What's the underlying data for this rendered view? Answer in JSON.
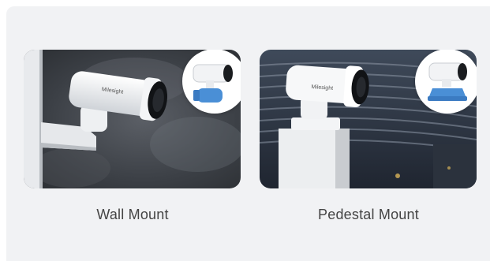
{
  "mount_options": [
    {
      "label": "Wall Mount",
      "brand": "Milesight"
    },
    {
      "label": "Pedestal Mount",
      "brand": "Milesight"
    }
  ],
  "colors": {
    "panel_background": "#f1f2f4",
    "caption_text": "#444444",
    "mount_accent": "#4a8fd6",
    "badge_background": "#ffffff"
  }
}
